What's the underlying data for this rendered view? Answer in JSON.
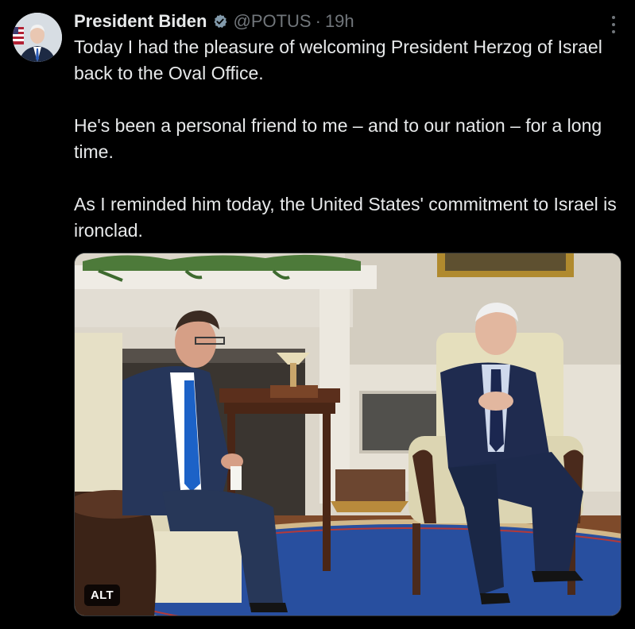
{
  "author": {
    "name": "President Biden",
    "handle": "@POTUS",
    "separator": "·",
    "time": "19h",
    "verified_icon": "verified-badge-icon",
    "avatar_icon": "avatar-portrait"
  },
  "tweet": {
    "paragraphs": [
      "Today I had the pleasure of welcoming President Herzog of Israel back to the Oval Office.",
      "He's been a personal friend to me – and to our nation – for a long time.",
      "As I reminded him today, the United States' commitment to Israel is ironclad."
    ]
  },
  "media": {
    "alt_label": "ALT",
    "image_icon": "oval-office-photo"
  },
  "menu": {
    "icon": "more-options-icon"
  },
  "colors": {
    "background": "#000000",
    "text_primary": "#e7e9ea",
    "text_secondary": "#71767b",
    "verified": "#829aab"
  }
}
